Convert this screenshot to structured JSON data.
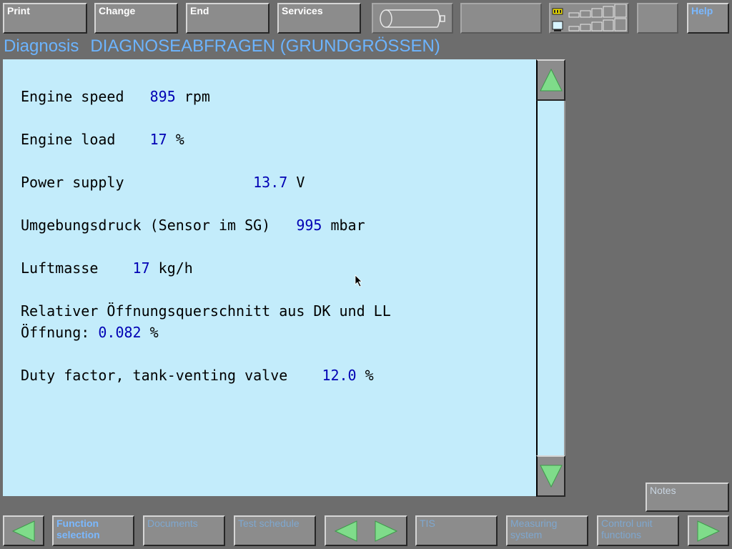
{
  "toolbar": {
    "print": "Print",
    "change": "Change",
    "end": "End",
    "services": "Services",
    "help": "Help"
  },
  "header": {
    "section": "Diagnosis",
    "title": "DIAGNOSEABFRAGEN (GRUNDGRÖSSEN)"
  },
  "readings": [
    {
      "label": "Engine speed   ",
      "value": "895",
      "unit": " rpm"
    },
    {
      "label": "Engine load    ",
      "value": "17",
      "unit": " %"
    },
    {
      "label": "Power supply               ",
      "value": "13.7",
      "unit": " V"
    },
    {
      "label": "Umgebungsdruck (Sensor im SG)   ",
      "value": "995",
      "unit": " mbar"
    },
    {
      "label": "Luftmasse    ",
      "value": "17",
      "unit": " kg/h"
    },
    {
      "label": "Relativer Öffnungsquerschnitt aus DK und LL",
      "label2": "Öffnung: ",
      "value": "0.082",
      "unit": " %"
    },
    {
      "label": "Duty factor, tank-venting valve    ",
      "value": "12.0",
      "unit": " %"
    }
  ],
  "side": {
    "notes": "Notes"
  },
  "bottom": {
    "function_selection": "Function selection",
    "documents": "Documents",
    "test_schedule": "Test schedule",
    "tis": "TIS",
    "measuring_system": "Measuring system",
    "control_unit_functions": "Control unit functions"
  },
  "colors": {
    "background": "#6d6d6d",
    "content_bg": "#c3ecfb",
    "value_text": "#0000b4",
    "title_text": "#6cb4ff",
    "arrow_green": "#7fdc8a"
  }
}
